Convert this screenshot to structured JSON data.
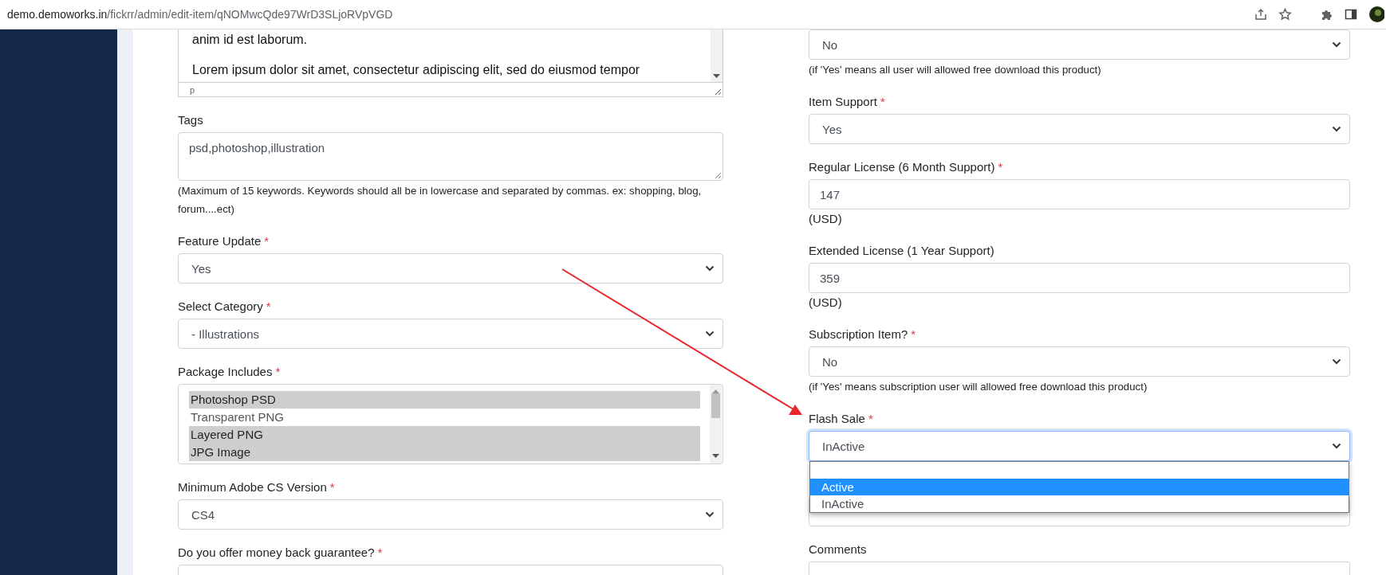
{
  "browser": {
    "url_host": "demo.demoworks.in",
    "url_path": "/fickrr/admin/edit-item/qNOMwcQde97WrD3SLjoRVpVGD"
  },
  "left_fields": [
    {
      "kind": "editor",
      "paragraphs": [
        "anim id est laborum.",
        "Lorem ipsum dolor sit amet, consectetur adipiscing elit, sed do eiusmod tempor"
      ],
      "status": "p"
    },
    {
      "kind": "textarea",
      "label": "Tags",
      "value": "psd,photoshop,illustration",
      "help": "(Maximum of 15 keywords. Keywords should all be in lowercase and separated by commas. ex: shopping, blog, forum....ect)"
    },
    {
      "kind": "select",
      "label": "Feature Update",
      "asterisk": "*",
      "value": "Yes"
    },
    {
      "kind": "select",
      "label": "Select Category",
      "asterisk": "*",
      "value": "- Illustrations"
    },
    {
      "kind": "multiselect",
      "label": "Package Includes",
      "asterisk": "*",
      "options": [
        {
          "label": "Photoshop PSD",
          "selected": true
        },
        {
          "label": "Transparent PNG",
          "selected": false
        },
        {
          "label": "Layered PNG",
          "selected": true
        },
        {
          "label": "JPG Image",
          "selected": true
        }
      ]
    },
    {
      "kind": "select",
      "label": "Minimum Adobe CS Version",
      "asterisk": "*",
      "value": "CS4"
    },
    {
      "kind": "select",
      "label": "Do you offer money back guarantee?",
      "asterisk": "*"
    }
  ],
  "right_fields": [
    {
      "kind": "select",
      "value": "No",
      "help": "(if 'Yes' means all user will allowed free download this product)"
    },
    {
      "kind": "select",
      "label": "Item Support",
      "asterisk": "*",
      "value": "Yes"
    },
    {
      "kind": "input",
      "label": "Regular License (6 Month Support)",
      "asterisk": "*",
      "value": "147",
      "suffix": "(USD)"
    },
    {
      "kind": "input",
      "label": "Extended License (1 Year Support)",
      "value": "359",
      "suffix": "(USD)"
    },
    {
      "kind": "select",
      "label": "Subscription Item?",
      "asterisk": "*",
      "value": "No",
      "help": "(if 'Yes' means subscription user will allowed free download this product)"
    },
    {
      "kind": "select",
      "label": "Flash Sale",
      "asterisk": "*",
      "value": "InActive",
      "focused": true,
      "menu": [
        {
          "label": "Active",
          "highlighted": true
        },
        {
          "label": "InActive",
          "highlighted": false
        }
      ]
    },
    {
      "kind": "covered"
    },
    {
      "kind": "textarea",
      "label": "Comments"
    }
  ]
}
